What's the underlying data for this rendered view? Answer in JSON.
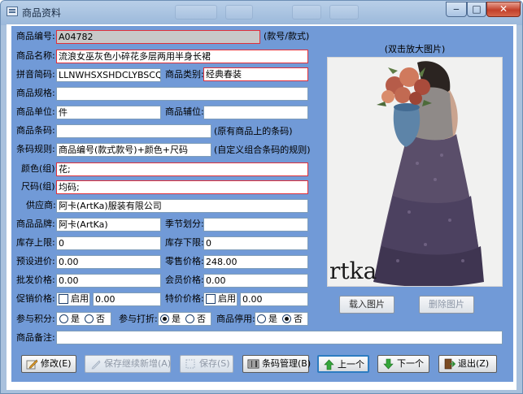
{
  "window": {
    "title": "商品资料",
    "controls": {
      "minimize": "‒",
      "maximize": "□",
      "close": "✕"
    }
  },
  "form": {
    "code": {
      "label": "商品编号:",
      "value": "A04782",
      "hint": "(款号/款式)"
    },
    "name": {
      "label": "商品名称:",
      "value": "流浪女巫灰色小碎花多层两用半身长裙"
    },
    "pinyin": {
      "label": "拼音简码:",
      "value": "LLNWHSXSHDCLYBSCQ"
    },
    "category": {
      "label": "商品类别:",
      "value": "经典春装"
    },
    "spec": {
      "label": "商品规格:",
      "value": ""
    },
    "unit": {
      "label": "商品单位:",
      "value": "件"
    },
    "aux_unit": {
      "label": "商品辅位:",
      "value": ""
    },
    "barcode": {
      "label": "商品条码:",
      "value": "",
      "hint": "(原有商品上的条码)"
    },
    "barcode_rule": {
      "label": "条码规则:",
      "value": "商品编号(款式款号)+颜色+尺码",
      "hint": "(自定义组合条码的规则)"
    },
    "color": {
      "label": "颜色(组):",
      "value": "花;"
    },
    "size": {
      "label": "尺码(组):",
      "value": "均码;"
    },
    "supplier": {
      "label": "供应商:",
      "value": "阿卡(ArtKa)服装有限公司"
    },
    "brand": {
      "label": "商品品牌:",
      "value": "阿卡(ArtKa)"
    },
    "season": {
      "label": "季节划分:",
      "value": ""
    },
    "stock_max": {
      "label": "库存上限:",
      "value": "0"
    },
    "stock_min": {
      "label": "库存下限:",
      "value": "0"
    },
    "preset_price": {
      "label": "预设进价:",
      "value": "0.00"
    },
    "retail_price": {
      "label": "零售价格:",
      "value": "248.00"
    },
    "wholesale_price": {
      "label": "批发价格:",
      "value": "0.00"
    },
    "member_price": {
      "label": "会员价格:",
      "value": "0.00"
    },
    "promo_price": {
      "label": "促销价格:",
      "enable": "启用",
      "value": "0.00",
      "checked": false
    },
    "special_price": {
      "label": "特价价格:",
      "enable": "启用",
      "value": "0.00",
      "checked": false
    },
    "points": {
      "label": "参与积分:",
      "yes": "是",
      "no": "否",
      "selected": "no"
    },
    "discount": {
      "label": "参与打折:",
      "yes": "是",
      "no": "否",
      "selected": "yes"
    },
    "disabled": {
      "label": "商品停用:",
      "yes": "是",
      "no": "否",
      "selected": "no"
    },
    "remark": {
      "label": "商品备注:",
      "value": ""
    }
  },
  "photo": {
    "hint": "(双击放大图片)",
    "brand_mark": "rtka",
    "load_button": "载入图片",
    "delete_button": "删除图片"
  },
  "toolbar": {
    "edit": "修改(E)",
    "save_continue": "保存继续新增(A)",
    "save": "保存(S)",
    "barcode_manage": "条码管理(B)",
    "prev": "上一个",
    "next": "下一个",
    "exit": "退出(Z)"
  },
  "colors": {
    "panel": "#719ad7",
    "required_border": "#e0303a",
    "titlebar": "#a9c1dd"
  }
}
